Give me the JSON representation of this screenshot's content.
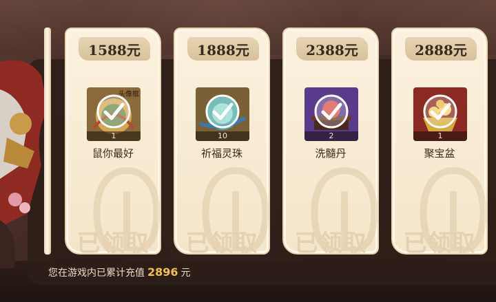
{
  "colors": {
    "card_bg": "#fbf1de",
    "price_badge": "#dcc7a2",
    "amount_highlight": "#f2c14a",
    "panel": "#2c1e18"
  },
  "cards": [
    {
      "price": "1588元",
      "item_name": "鼠你最好",
      "item_count": "1",
      "item_tag": "头像框",
      "icon": "avatar-frame-icon",
      "status": "已领取"
    },
    {
      "price": "1888元",
      "item_name": "祈福灵珠",
      "item_count": "10",
      "item_tag": "",
      "icon": "blessing-orb-icon",
      "status": "已领取"
    },
    {
      "price": "2388元",
      "item_name": "洗髓丹",
      "item_count": "2",
      "item_tag": "",
      "icon": "elixir-pill-icon",
      "status": "已领取"
    },
    {
      "price": "2888元",
      "item_name": "聚宝盆",
      "item_count": "1",
      "item_tag": "",
      "icon": "treasure-bowl-icon",
      "status": "已领取"
    }
  ],
  "footer": {
    "prefix": "您在游戏内已累计充值",
    "amount": "2896",
    "unit": "元"
  }
}
